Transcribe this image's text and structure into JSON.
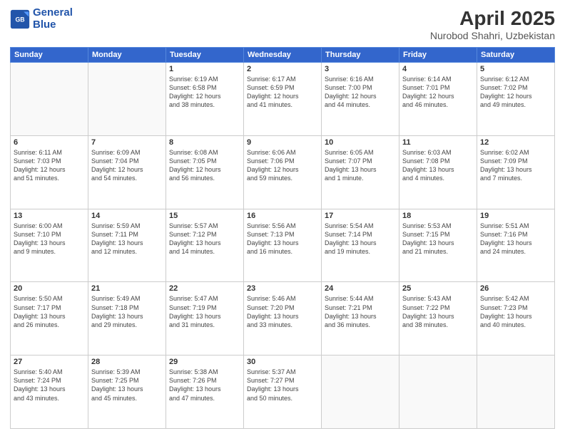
{
  "header": {
    "logo_line1": "General",
    "logo_line2": "Blue",
    "month": "April 2025",
    "location": "Nurobod Shahri, Uzbekistan"
  },
  "weekdays": [
    "Sunday",
    "Monday",
    "Tuesday",
    "Wednesday",
    "Thursday",
    "Friday",
    "Saturday"
  ],
  "rows": [
    [
      {
        "day": "",
        "info": ""
      },
      {
        "day": "",
        "info": ""
      },
      {
        "day": "1",
        "info": "Sunrise: 6:19 AM\nSunset: 6:58 PM\nDaylight: 12 hours\nand 38 minutes."
      },
      {
        "day": "2",
        "info": "Sunrise: 6:17 AM\nSunset: 6:59 PM\nDaylight: 12 hours\nand 41 minutes."
      },
      {
        "day": "3",
        "info": "Sunrise: 6:16 AM\nSunset: 7:00 PM\nDaylight: 12 hours\nand 44 minutes."
      },
      {
        "day": "4",
        "info": "Sunrise: 6:14 AM\nSunset: 7:01 PM\nDaylight: 12 hours\nand 46 minutes."
      },
      {
        "day": "5",
        "info": "Sunrise: 6:12 AM\nSunset: 7:02 PM\nDaylight: 12 hours\nand 49 minutes."
      }
    ],
    [
      {
        "day": "6",
        "info": "Sunrise: 6:11 AM\nSunset: 7:03 PM\nDaylight: 12 hours\nand 51 minutes."
      },
      {
        "day": "7",
        "info": "Sunrise: 6:09 AM\nSunset: 7:04 PM\nDaylight: 12 hours\nand 54 minutes."
      },
      {
        "day": "8",
        "info": "Sunrise: 6:08 AM\nSunset: 7:05 PM\nDaylight: 12 hours\nand 56 minutes."
      },
      {
        "day": "9",
        "info": "Sunrise: 6:06 AM\nSunset: 7:06 PM\nDaylight: 12 hours\nand 59 minutes."
      },
      {
        "day": "10",
        "info": "Sunrise: 6:05 AM\nSunset: 7:07 PM\nDaylight: 13 hours\nand 1 minute."
      },
      {
        "day": "11",
        "info": "Sunrise: 6:03 AM\nSunset: 7:08 PM\nDaylight: 13 hours\nand 4 minutes."
      },
      {
        "day": "12",
        "info": "Sunrise: 6:02 AM\nSunset: 7:09 PM\nDaylight: 13 hours\nand 7 minutes."
      }
    ],
    [
      {
        "day": "13",
        "info": "Sunrise: 6:00 AM\nSunset: 7:10 PM\nDaylight: 13 hours\nand 9 minutes."
      },
      {
        "day": "14",
        "info": "Sunrise: 5:59 AM\nSunset: 7:11 PM\nDaylight: 13 hours\nand 12 minutes."
      },
      {
        "day": "15",
        "info": "Sunrise: 5:57 AM\nSunset: 7:12 PM\nDaylight: 13 hours\nand 14 minutes."
      },
      {
        "day": "16",
        "info": "Sunrise: 5:56 AM\nSunset: 7:13 PM\nDaylight: 13 hours\nand 16 minutes."
      },
      {
        "day": "17",
        "info": "Sunrise: 5:54 AM\nSunset: 7:14 PM\nDaylight: 13 hours\nand 19 minutes."
      },
      {
        "day": "18",
        "info": "Sunrise: 5:53 AM\nSunset: 7:15 PM\nDaylight: 13 hours\nand 21 minutes."
      },
      {
        "day": "19",
        "info": "Sunrise: 5:51 AM\nSunset: 7:16 PM\nDaylight: 13 hours\nand 24 minutes."
      }
    ],
    [
      {
        "day": "20",
        "info": "Sunrise: 5:50 AM\nSunset: 7:17 PM\nDaylight: 13 hours\nand 26 minutes."
      },
      {
        "day": "21",
        "info": "Sunrise: 5:49 AM\nSunset: 7:18 PM\nDaylight: 13 hours\nand 29 minutes."
      },
      {
        "day": "22",
        "info": "Sunrise: 5:47 AM\nSunset: 7:19 PM\nDaylight: 13 hours\nand 31 minutes."
      },
      {
        "day": "23",
        "info": "Sunrise: 5:46 AM\nSunset: 7:20 PM\nDaylight: 13 hours\nand 33 minutes."
      },
      {
        "day": "24",
        "info": "Sunrise: 5:44 AM\nSunset: 7:21 PM\nDaylight: 13 hours\nand 36 minutes."
      },
      {
        "day": "25",
        "info": "Sunrise: 5:43 AM\nSunset: 7:22 PM\nDaylight: 13 hours\nand 38 minutes."
      },
      {
        "day": "26",
        "info": "Sunrise: 5:42 AM\nSunset: 7:23 PM\nDaylight: 13 hours\nand 40 minutes."
      }
    ],
    [
      {
        "day": "27",
        "info": "Sunrise: 5:40 AM\nSunset: 7:24 PM\nDaylight: 13 hours\nand 43 minutes."
      },
      {
        "day": "28",
        "info": "Sunrise: 5:39 AM\nSunset: 7:25 PM\nDaylight: 13 hours\nand 45 minutes."
      },
      {
        "day": "29",
        "info": "Sunrise: 5:38 AM\nSunset: 7:26 PM\nDaylight: 13 hours\nand 47 minutes."
      },
      {
        "day": "30",
        "info": "Sunrise: 5:37 AM\nSunset: 7:27 PM\nDaylight: 13 hours\nand 50 minutes."
      },
      {
        "day": "",
        "info": ""
      },
      {
        "day": "",
        "info": ""
      },
      {
        "day": "",
        "info": ""
      }
    ]
  ]
}
